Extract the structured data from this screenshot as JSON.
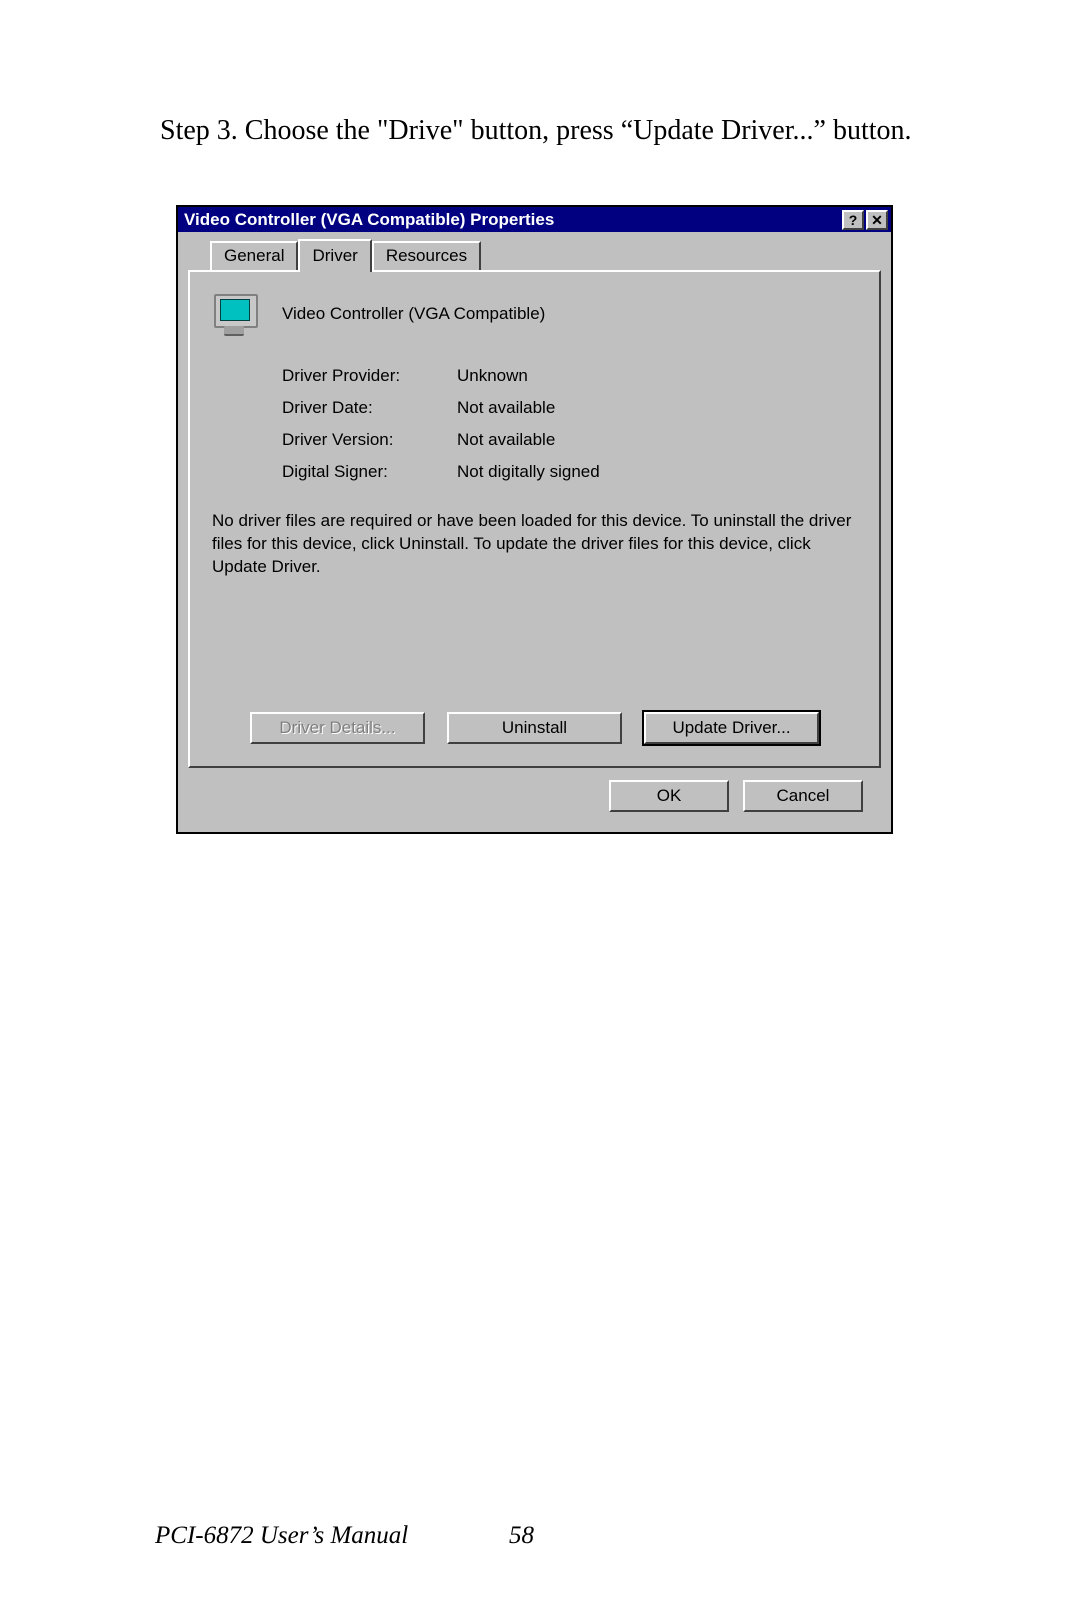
{
  "instruction": "Step 3.  Choose the \"Drive\" button, press “Update Driver...” button.",
  "dialog": {
    "title": "Video Controller (VGA Compatible) Properties",
    "help_symbol": "?",
    "close_symbol": "✕",
    "tabs": {
      "general": "General",
      "driver": "Driver",
      "resources": "Resources"
    },
    "device_name": "Video Controller (VGA Compatible)",
    "fields": {
      "provider_label": "Driver Provider:",
      "provider_value": "Unknown",
      "date_label": "Driver Date:",
      "date_value": "Not available",
      "version_label": "Driver Version:",
      "version_value": "Not available",
      "signer_label": "Digital Signer:",
      "signer_value": "Not digitally signed"
    },
    "description": "No driver files are required or have been loaded for this device. To uninstall the driver files for this device, click Uninstall. To update the driver files for this device, click Update Driver.",
    "buttons": {
      "details": "Driver Details...",
      "uninstall": "Uninstall",
      "update": "Update Driver...",
      "ok": "OK",
      "cancel": "Cancel"
    }
  },
  "footer": {
    "manual": "PCI-6872 User’s Manual",
    "page": "58"
  }
}
